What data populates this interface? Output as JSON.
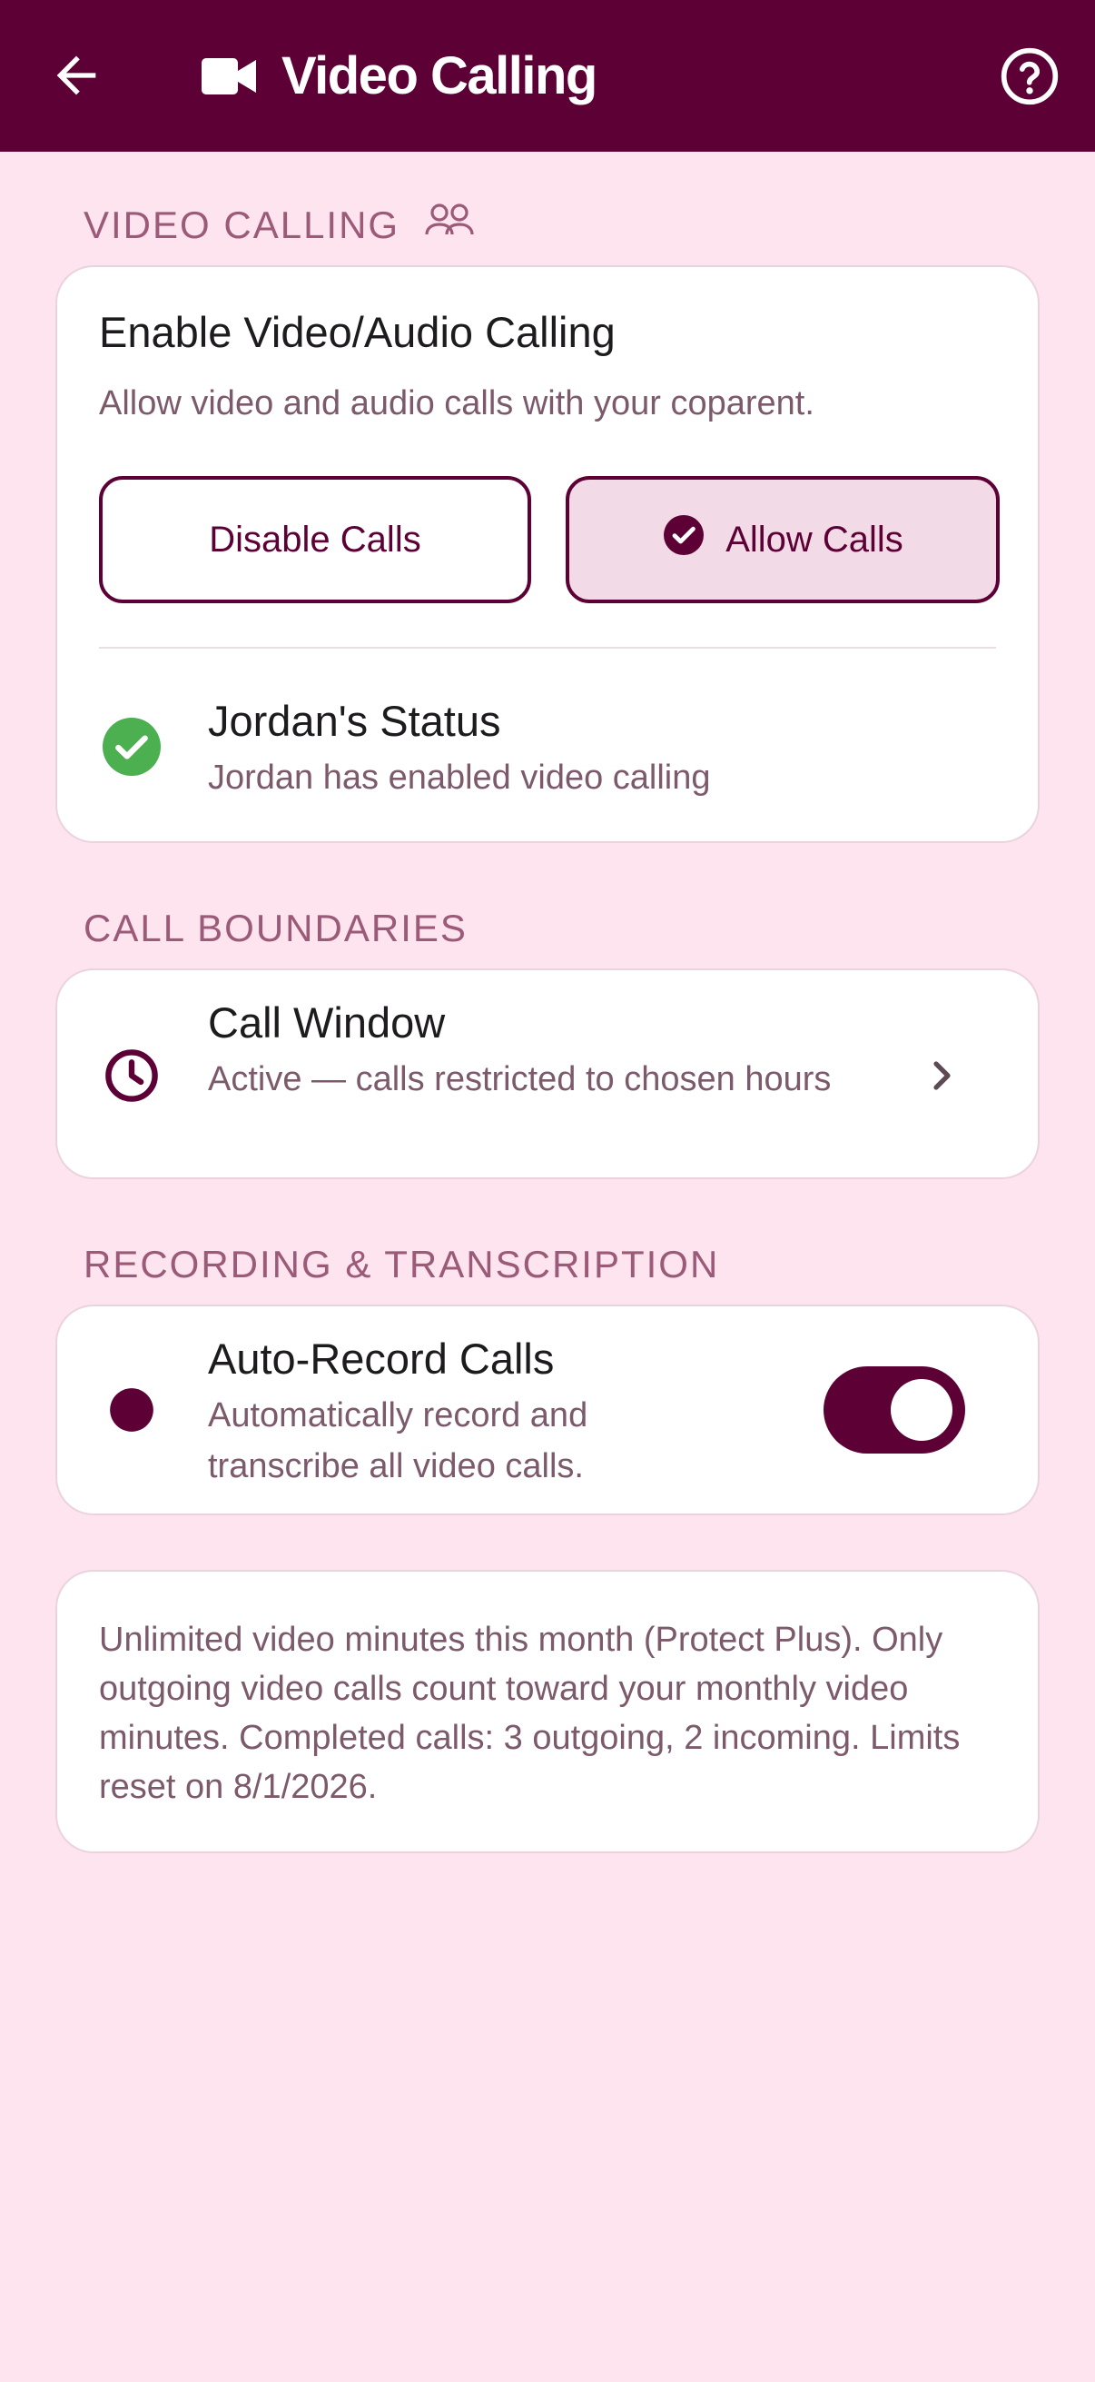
{
  "app_bar": {
    "title": "Video Calling",
    "back_icon": "arrow-back-icon",
    "title_icon": "videocam-icon",
    "help_icon": "help-circle-icon"
  },
  "video_calling": {
    "section_header": "VIDEO CALLING",
    "section_icon": "group-icon",
    "title": "Enable Video/Audio Calling",
    "subtitle": "Allow video and audio calls with your coparent.",
    "disable_label": "Disable Calls",
    "allow_label": "Allow Calls",
    "selected": "allow",
    "status_title": "Jordan's Status",
    "status_text": "Jordan has enabled video calling"
  },
  "call_boundaries": {
    "section_header": "CALL BOUNDARIES",
    "title": "Call Window",
    "subtitle": "Active — calls restricted to chosen hours"
  },
  "recording": {
    "section_header": "RECORDING & TRANSCRIPTION",
    "title": "Auto-Record Calls",
    "subtitle": "Automatically record and transcribe all video calls.",
    "enabled": true
  },
  "info": {
    "text": "Unlimited video minutes this month (Protect Plus). Only outgoing video calls count toward your monthly video minutes. Completed calls: 3 outgoing, 2 incoming. Limits reset on 8/1/2026."
  },
  "colors": {
    "primary": "#5c0036",
    "background": "#fde4ee",
    "success": "#4caf50",
    "muted_text": "#7c5a6b"
  }
}
